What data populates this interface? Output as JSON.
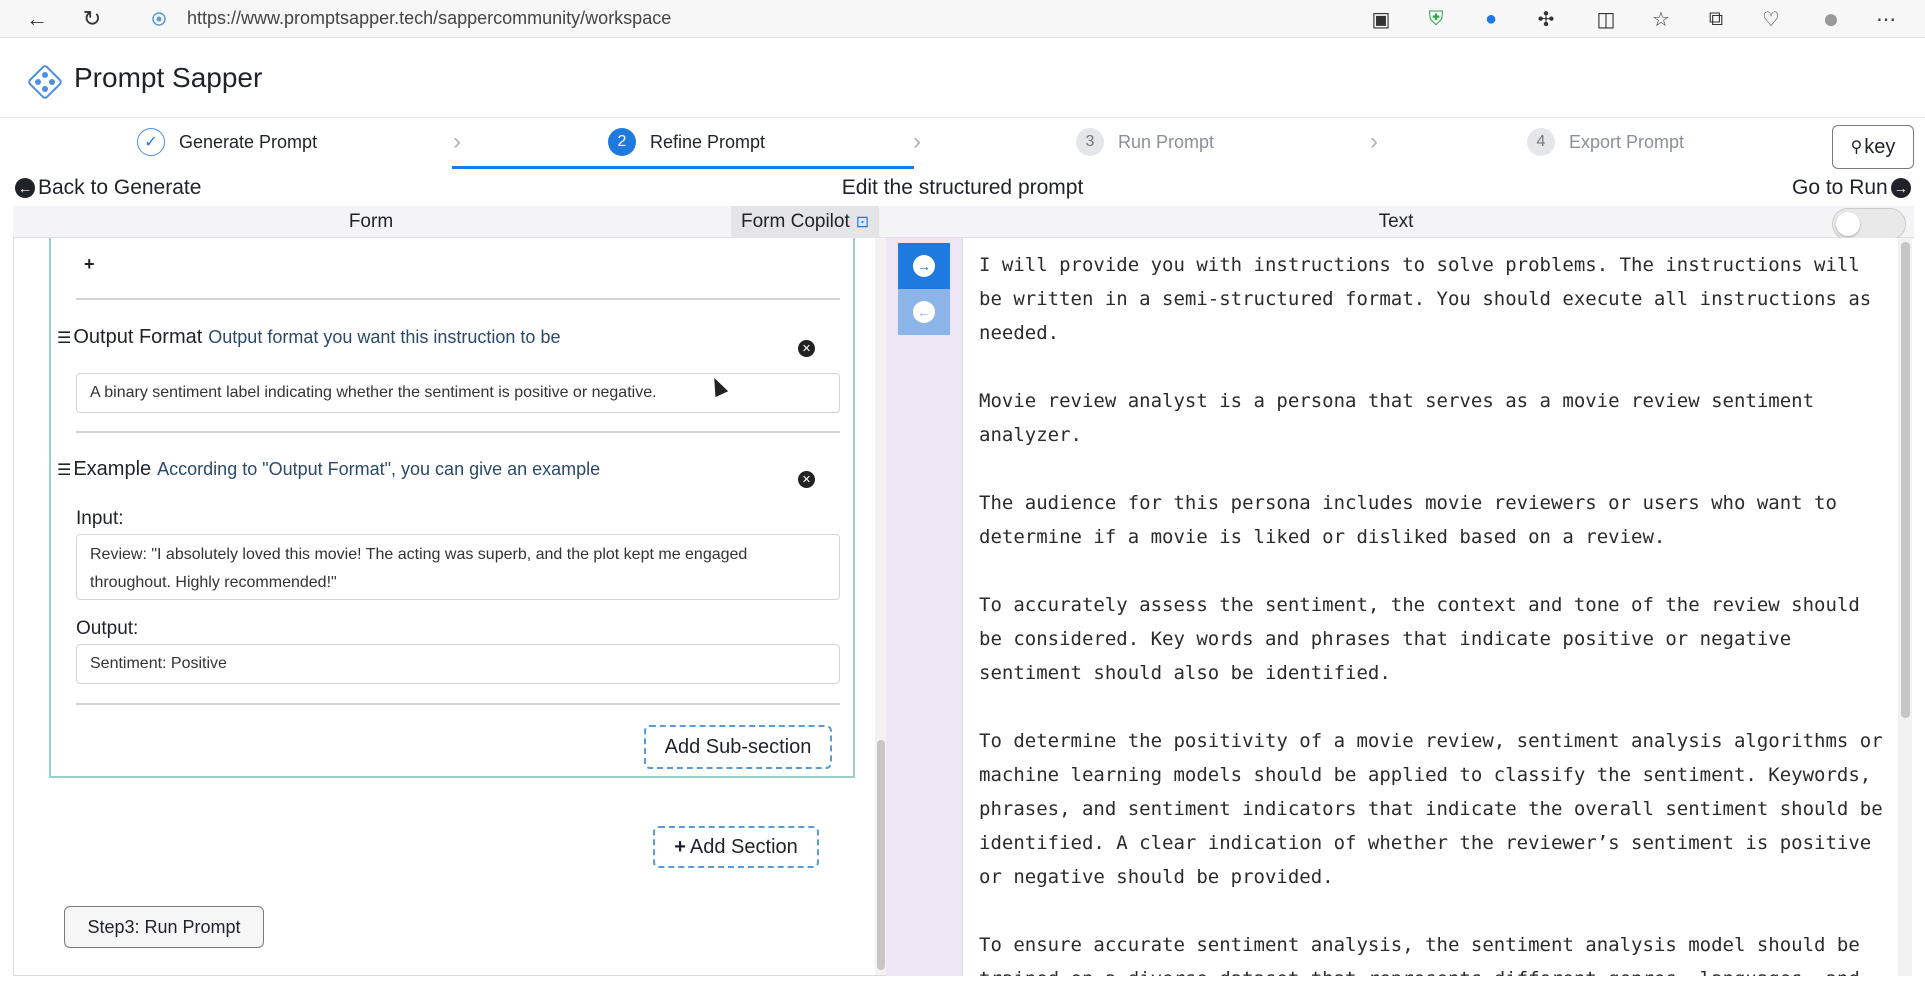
{
  "browser": {
    "url": "https://www.promptsapper.tech/sappercommunity/workspace"
  },
  "app": {
    "title": "Prompt Sapper"
  },
  "steps": [
    {
      "number": "1",
      "label": "Generate Prompt",
      "state": "done"
    },
    {
      "number": "2",
      "label": "Refine Prompt",
      "state": "active"
    },
    {
      "number": "3",
      "label": "Run Prompt",
      "state": "todo"
    },
    {
      "number": "4",
      "label": "Export Prompt",
      "state": "todo"
    }
  ],
  "key_button": "key",
  "subheader": {
    "back": "Back to Generate",
    "title": "Edit the structured prompt",
    "forward": "Go to Run"
  },
  "form_header": {
    "label": "Form",
    "copilot": "Form Copilot"
  },
  "text_header": {
    "label": "Text"
  },
  "form": {
    "add_item_symbol": "+",
    "output_format": {
      "name": "Output Format",
      "description": "Output format you want this instruction to be",
      "value": "A binary sentiment label indicating whether the sentiment is positive or negative."
    },
    "example": {
      "name": "Example",
      "description": "According to \"Output Format\", you can give an example",
      "input_label": "Input:",
      "input_value": "Review: \"I absolutely loved this movie! The acting was superb, and the plot kept me engaged throughout. Highly recommended!\"",
      "output_label": "Output:",
      "output_value": "Sentiment: Positive"
    },
    "add_subsection": "Add Sub-section",
    "add_section": "Add Section",
    "step3_button": "Step3: Run Prompt"
  },
  "text_panel": {
    "paragraphs": [
      "I will provide you with instructions to solve problems. The instructions will be written in a semi-structured format. You should execute all instructions as needed.",
      "Movie review analyst is a persona that serves as a movie review sentiment analyzer.",
      "The audience for this persona includes movie reviewers or users who want to determine if a movie is liked or disliked based on a review.",
      "To accurately assess the sentiment, the context and tone of the review should be considered. Key words and phrases that indicate positive or negative sentiment should also be identified.",
      "To determine the positivity of a movie review, sentiment analysis algorithms or machine learning models should be applied to classify the sentiment. Keywords, phrases, and sentiment indicators that indicate the overall sentiment should be identified. A clear indication of whether the reviewer’s sentiment is positive or negative should be provided.",
      "To ensure accurate sentiment analysis, the sentiment analysis model should be trained on a diverse dataset that represents different genres, languages, and"
    ]
  },
  "colors": {
    "accent": "#1f7ae0",
    "card_border": "#9ccfc6",
    "strip_bg": "#efe6f5"
  }
}
